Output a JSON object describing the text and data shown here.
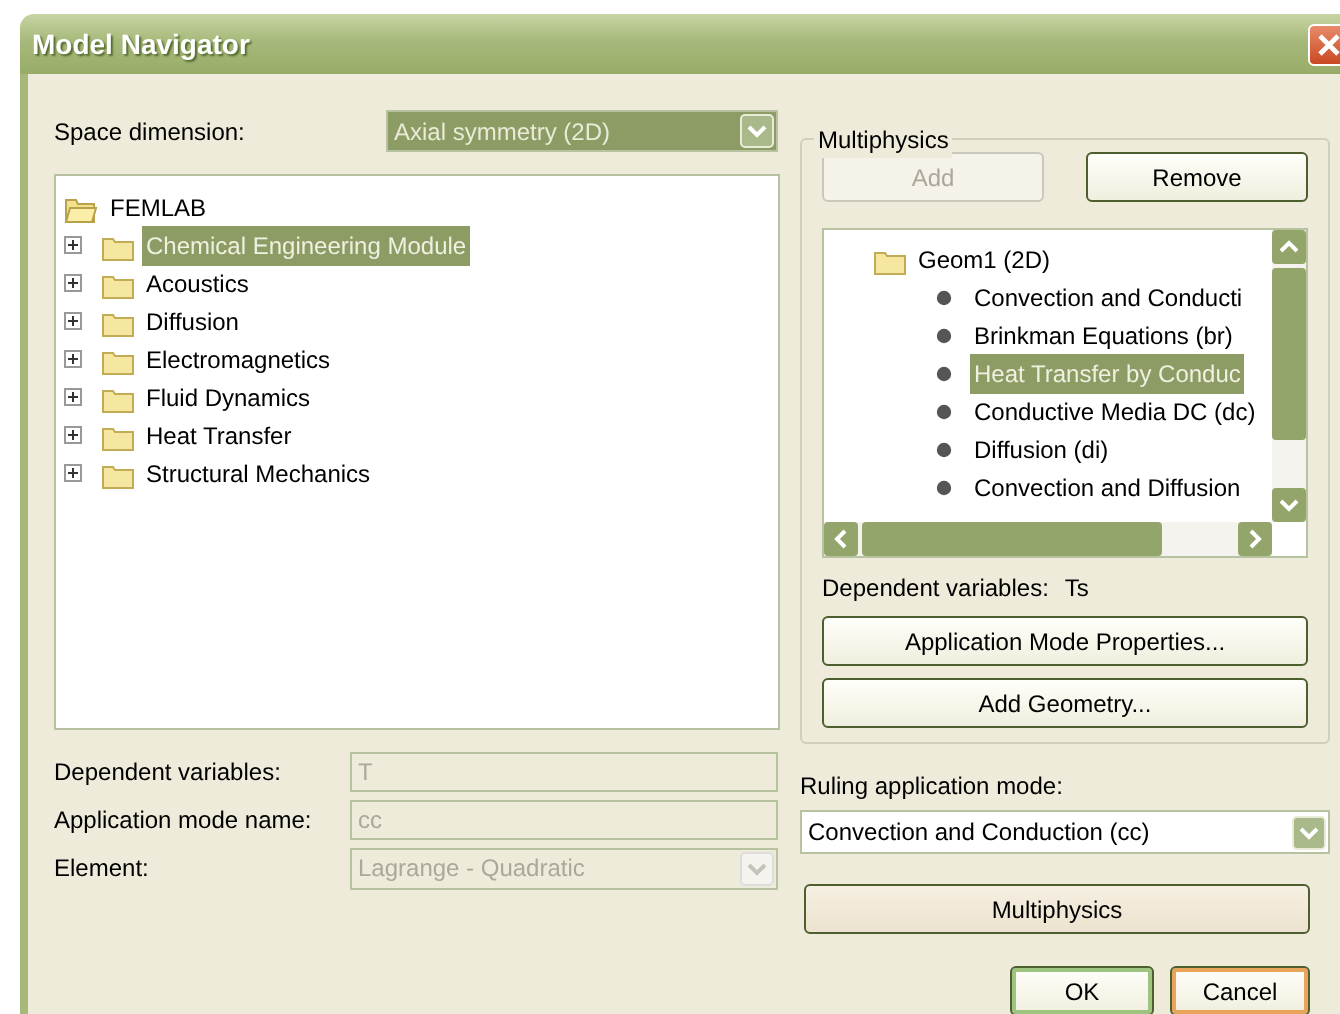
{
  "window": {
    "title": "Model Navigator"
  },
  "space_dimension": {
    "label": "Space dimension:",
    "value": "Axial symmetry (2D)",
    "focused": true
  },
  "model_tree": [
    {
      "label": "FEMLAB",
      "kind": "open-folder",
      "selected": false,
      "children": [
        {
          "label": "Chemical Engineering Module",
          "kind": "folder",
          "expanded": false,
          "selected": true
        },
        {
          "label": "Acoustics",
          "kind": "folder",
          "expanded": false,
          "selected": false
        },
        {
          "label": "Diffusion",
          "kind": "folder",
          "expanded": false,
          "selected": false
        },
        {
          "label": "Electromagnetics",
          "kind": "folder",
          "expanded": false,
          "selected": false
        },
        {
          "label": "Fluid Dynamics",
          "kind": "folder",
          "expanded": false,
          "selected": false
        },
        {
          "label": "Heat Transfer",
          "kind": "folder",
          "expanded": false,
          "selected": false
        },
        {
          "label": "Structural Mechanics",
          "kind": "folder",
          "expanded": false,
          "selected": false
        }
      ]
    }
  ],
  "properties": [
    {
      "label": "Dependent variables:",
      "value": "T",
      "kind": "text",
      "disabled": true
    },
    {
      "label": "Application mode name:",
      "value": "cc",
      "kind": "text",
      "disabled": true
    },
    {
      "label": "Element:",
      "value": "Lagrange - Quadratic",
      "kind": "select",
      "disabled": true
    }
  ],
  "multiphysics": {
    "title": "Multiphysics",
    "buttons": [
      {
        "label": "Add",
        "disabled": true
      },
      {
        "label": "Remove",
        "disabled": false
      }
    ],
    "tree": [
      {
        "label": "Geom1 (2D)",
        "kind": "folder",
        "selected": false,
        "children": [
          {
            "label": "Convection and Conducti",
            "kind": "mode",
            "selected": false
          },
          {
            "label": "Brinkman Equations (br)",
            "kind": "mode",
            "selected": false
          },
          {
            "label": "Heat Transfer by Conduc",
            "kind": "mode",
            "selected": true
          },
          {
            "label": "Conductive Media DC (dc)",
            "kind": "mode",
            "selected": false
          },
          {
            "label": "Diffusion (di)",
            "kind": "mode",
            "selected": false
          },
          {
            "label": "Convection and Diffusion",
            "kind": "mode",
            "selected": false
          }
        ]
      }
    ],
    "dependent_variables": {
      "label": "Dependent variables:",
      "value": "Ts"
    },
    "actions": [
      {
        "label": "Application Mode Properties..."
      },
      {
        "label": "Add Geometry..."
      }
    ]
  },
  "ruling_mode": {
    "label": "Ruling application mode:",
    "value": "Convection and Conduction (cc)"
  },
  "multiphysics_button": {
    "label": "Multiphysics"
  },
  "dialog_buttons": [
    {
      "label": "OK",
      "kind": "default"
    },
    {
      "label": "Cancel",
      "kind": "hover"
    }
  ]
}
